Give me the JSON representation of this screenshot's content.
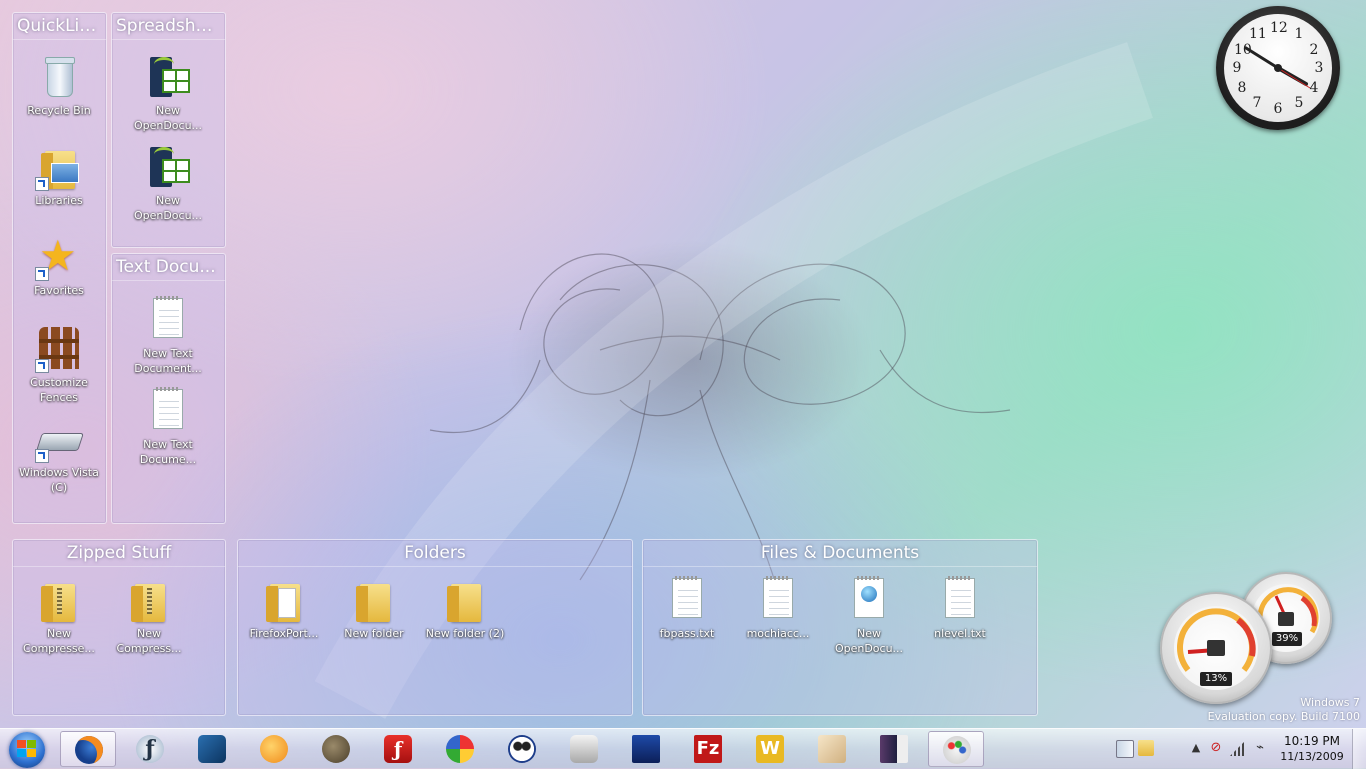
{
  "fences": {
    "quicklinks": {
      "title": "QuickLinks",
      "items": [
        "Recycle Bin",
        "Libraries",
        "Favorites",
        "Customize Fences",
        "Windows Vista (C)"
      ]
    },
    "spreadsheets": {
      "title": "Spreadshe...",
      "items": [
        "New OpenDocu...",
        "New OpenDocu..."
      ]
    },
    "textdocs": {
      "title": "Text Docu...",
      "items": [
        "New Text Document...",
        "New Text Docume..."
      ]
    },
    "zipped": {
      "title": "Zipped Stuff",
      "items": [
        "New Compresse...",
        "New Compress..."
      ]
    },
    "folders": {
      "title": "Folders",
      "items": [
        "FirefoxPort...",
        "New folder",
        "New folder (2)"
      ]
    },
    "files": {
      "title": "Files & Documents",
      "items": [
        "fbpass.txt",
        "mochiacc...",
        "New OpenDocu...",
        "nlevel.txt"
      ]
    }
  },
  "clock_gadget": {
    "numbers": [
      "12",
      "1",
      "2",
      "3",
      "4",
      "5",
      "6",
      "7",
      "8",
      "9",
      "10",
      "11"
    ],
    "time": "10:19"
  },
  "meter_gadget": {
    "cpu_percent": "13%",
    "memory_percent": "39%"
  },
  "watermark": {
    "line1": "Windows 7",
    "line2": "Evaluation copy. Build 7100"
  },
  "taskbar": {
    "pinned": [
      "firefox-icon",
      "flash-icon",
      "dreamweaver-icon",
      "bird-game-icon",
      "gimp-icon",
      "flash-player-icon",
      "filezilla-ball-icon",
      "panda-icon",
      "camera-icon",
      "sim-2006-icon",
      "filezilla-icon",
      "wordpad-w-icon",
      "sketch-icon",
      "simcity4-icon",
      "paint-icon"
    ],
    "active_index": 0,
    "clock_time": "10:19 PM",
    "clock_date": "11/13/2009"
  },
  "colors": {
    "accent": "#2c6fcf",
    "fence_bg": "#c8beeb"
  }
}
